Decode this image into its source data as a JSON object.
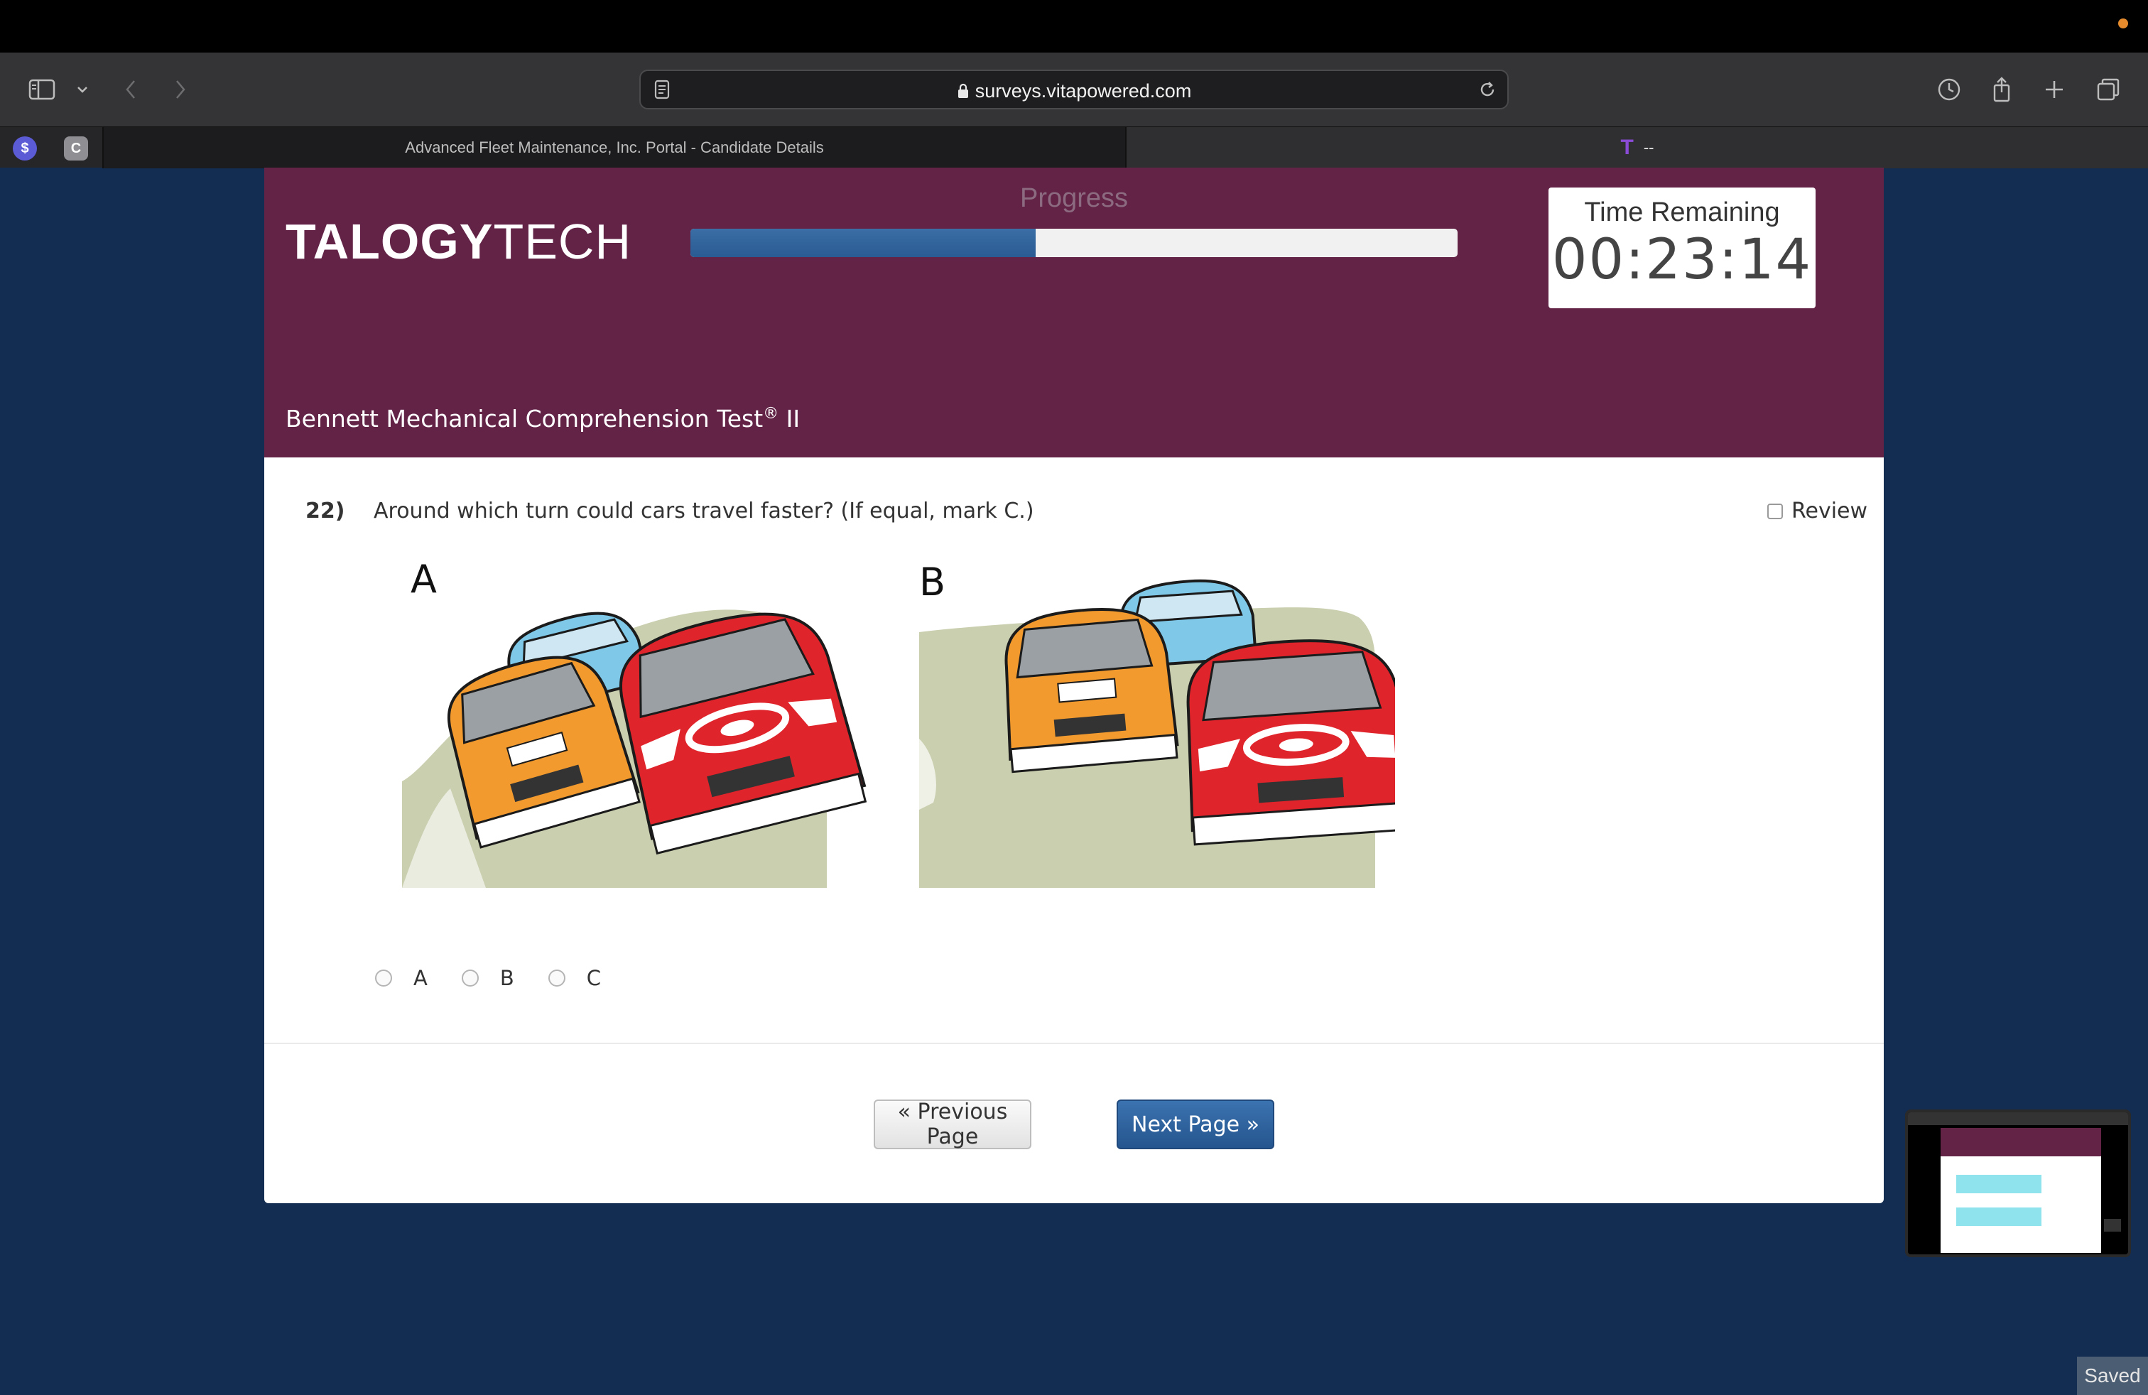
{
  "browser": {
    "url": "surveys.vitapowered.com",
    "tabs": [
      {
        "label": "Advanced Fleet Maintenance, Inc. Portal - Candidate Details",
        "active": false
      },
      {
        "label": "--",
        "active": true
      }
    ],
    "pinned": [
      {
        "glyph": "$",
        "color": "#5b5bd6"
      },
      {
        "glyph": "C",
        "color": "#8e8e93"
      }
    ]
  },
  "header": {
    "logo_bold": "TALOGY",
    "logo_light": "TECH",
    "progress_label": "Progress",
    "progress_fraction": 0.45,
    "timer_label": "Time Remaining",
    "timer_value": "00:23:14",
    "test_title": "Bennett Mechanical Comprehension Test",
    "test_title_mark": "®",
    "test_title_suffix": " II",
    "background_color": "#622347"
  },
  "question": {
    "number": "22)",
    "text": "Around which turn could cars travel faster? (If equal, mark C.)",
    "review_label": "Review",
    "figure_labels": [
      "A",
      "B"
    ],
    "options": [
      {
        "label": "A",
        "selected": false
      },
      {
        "label": "B",
        "selected": false
      },
      {
        "label": "C",
        "selected": false
      }
    ]
  },
  "navigation": {
    "previous_label": "« Previous Page",
    "next_label": "Next Page »",
    "next_color": "#2b5b93"
  },
  "status": {
    "saved_label": "Saved"
  }
}
